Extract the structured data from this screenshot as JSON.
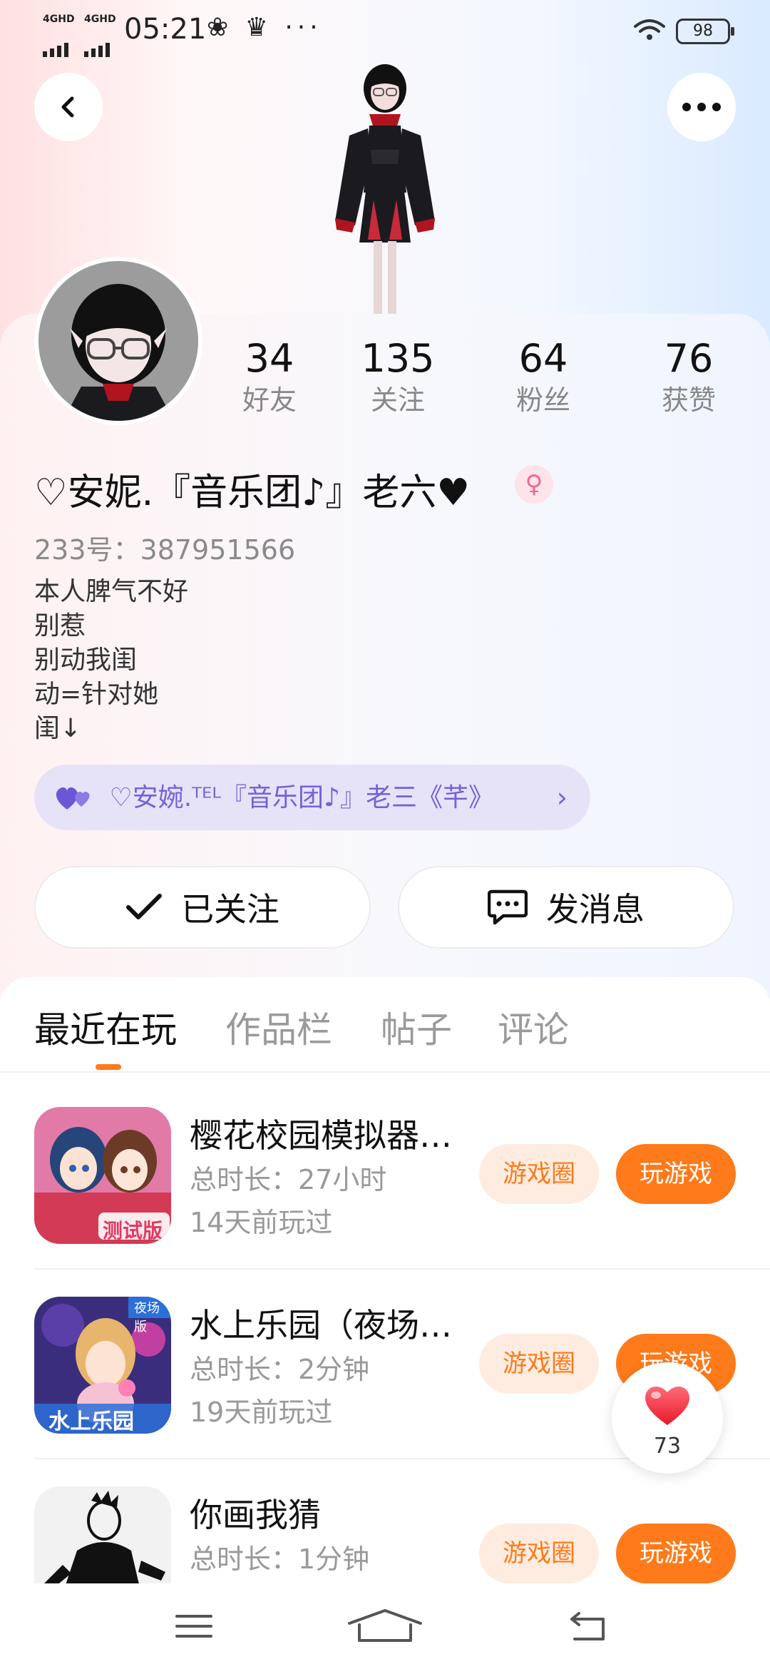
{
  "status_bar": {
    "network_1": "4GHD",
    "network_2": "4GHD",
    "time": "05:21",
    "extra": "❀ ♛ ···",
    "battery": "98"
  },
  "header": {
    "back_icon": "chevron-left-icon",
    "more_icon": "more-horizontal-icon"
  },
  "profile": {
    "stats": [
      {
        "value": "34",
        "label": "好友"
      },
      {
        "value": "135",
        "label": "关注"
      },
      {
        "value": "64",
        "label": "粉丝"
      },
      {
        "value": "76",
        "label": "获赞"
      }
    ],
    "name": "♡安妮.『音乐团♪』老六♥",
    "gender_symbol": "♀",
    "uid": "233号：387951566",
    "bio": [
      "本人脾气不好",
      "别惹",
      "别动我闺",
      "动=针对她",
      "闺↓"
    ],
    "relation": {
      "text": "♡安婉.ᵀᴱᴸ『音乐团♪』老三《芊》",
      "arrow": "›"
    }
  },
  "actions": {
    "follow_label": "已关注",
    "message_label": "发消息"
  },
  "tabs": [
    {
      "label": "最近在玩",
      "active": true
    },
    {
      "label": "作品栏",
      "active": false
    },
    {
      "label": "帖子",
      "active": false
    },
    {
      "label": "评论",
      "active": false
    }
  ],
  "games": [
    {
      "title": "樱花校园模拟器…",
      "duration": "总时长：27小时",
      "last_played": "14天前玩过",
      "circle_label": "游戏圈",
      "play_label": "玩游戏",
      "icon_badge": "测试版"
    },
    {
      "title": "水上乐园（夜场…",
      "duration": "总时长：2分钟",
      "last_played": "19天前玩过",
      "circle_label": "游戏圈",
      "play_label": "玩游戏",
      "icon_badge": "水上乐园",
      "icon_corner": "夜场版"
    },
    {
      "title": "你画我猜",
      "duration": "总时长：1分钟",
      "circle_label": "游戏圈",
      "play_label": "玩游戏"
    }
  ],
  "floating_like": {
    "count": "73"
  },
  "colors": {
    "accent": "#ff7a1a",
    "accent_light": "#ffece0",
    "relation_bg": "#e6e3f8",
    "relation_text": "#7462d8",
    "like_red": "#f0384a"
  }
}
